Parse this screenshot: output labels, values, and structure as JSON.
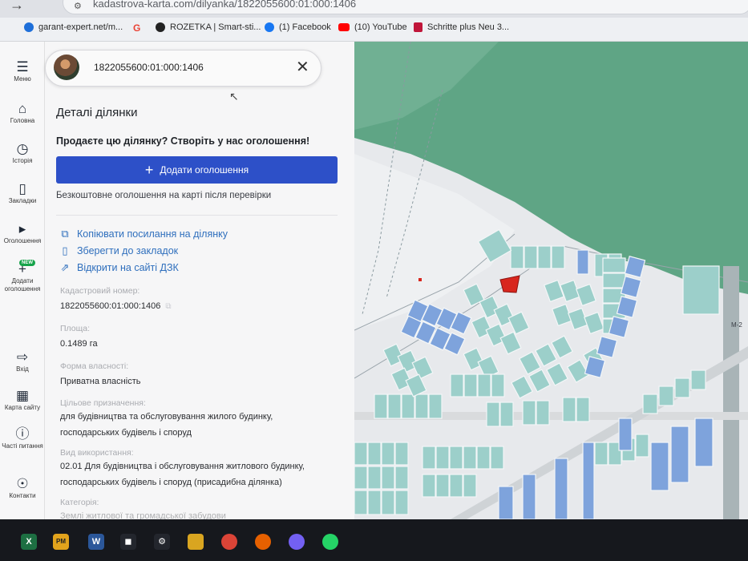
{
  "browser": {
    "url": "kadastrova-karta.com/dilyanka/1822055600:01:000:1406",
    "bookmarks": [
      {
        "label": "garant-expert.net/m...",
        "icon": "drop-icon",
        "color": "#1e6fd9"
      },
      {
        "label": "",
        "icon": "google-icon",
        "color": "#ea4335"
      },
      {
        "label": "ROZETKA | Smart-sti...",
        "icon": "rozetka-icon",
        "color": "#222222"
      },
      {
        "label": "(1) Facebook",
        "icon": "facebook-icon",
        "color": "#1877f2"
      },
      {
        "label": "(10) YouTube",
        "icon": "youtube-icon",
        "color": "#ff0000"
      },
      {
        "label": "Schritte plus Neu 3...",
        "icon": "book-icon",
        "color": "#c0163a"
      }
    ]
  },
  "sidebar": {
    "items": [
      {
        "label": "Меню",
        "icon": "hamburger-icon"
      },
      {
        "label": "Головна",
        "icon": "home-icon"
      },
      {
        "label": "Історія",
        "icon": "clock-icon"
      },
      {
        "label": "Закладки",
        "icon": "bookmark-icon"
      },
      {
        "label": "Оголошення",
        "icon": "megaphone-icon"
      },
      {
        "label": "Додати оголошення",
        "icon": "plus-icon",
        "badge": "NEW"
      },
      {
        "label": "Вхід",
        "icon": "login-icon"
      },
      {
        "label": "Карта сайту",
        "icon": "map-icon"
      },
      {
        "label": "Часті питання",
        "icon": "question-icon"
      },
      {
        "label": "Контакти",
        "icon": "chat-icon"
      }
    ]
  },
  "panel": {
    "search_value": "1822055600:01:000:1406",
    "title": "Деталі ділянки",
    "sell_question": "Продаєте цю ділянку? Створіть у нас оголошення!",
    "add_button": "Додати оголошення",
    "free_note": "Безкоштовне оголошення на карті після перевірки",
    "links": [
      {
        "label": "Копіювати посилання на ділянку",
        "icon": "copy-icon"
      },
      {
        "label": "Зберегти до закладок",
        "icon": "bookmark-icon"
      },
      {
        "label": "Відкрити на сайті ДЗК",
        "icon": "external-link-icon"
      }
    ],
    "fields": [
      {
        "label": "Кадастровий номер:",
        "value": "1822055600:01:000:1406"
      },
      {
        "label": "Площа:",
        "value": "0.1489 га"
      },
      {
        "label": "Форма власності:",
        "value": "Приватна власність"
      },
      {
        "label": "Цільове призначення:",
        "value": "для будівництва та обслуговування жилого будинку, господарських будівель і споруд"
      },
      {
        "label": "Вид використання:",
        "value": "02.01 Для будівництва і обслуговування житлового будинку, господарських будівель і споруд (присадибна ділянка)"
      },
      {
        "label": "Категорія:",
        "value": "Землі житлової та громадської забудови"
      }
    ]
  },
  "map": {
    "road_label": "М-2",
    "colors": {
      "forest": "#5fa585",
      "parcel_teal": "#9ccfca",
      "parcel_blue": "#7ea3dc",
      "selected": "#d8261e",
      "background": "#e7e9ec"
    }
  },
  "taskbar": {
    "apps": [
      {
        "label": "X",
        "icon": "excel-icon",
        "color": "#1d6f42"
      },
      {
        "label": "PM",
        "icon": "pm-icon",
        "color": "#e2a31c"
      },
      {
        "label": "W",
        "icon": "word-icon",
        "color": "#2b579a"
      },
      {
        "label": "",
        "icon": "shield-icon",
        "color": "#23262d"
      },
      {
        "label": "",
        "icon": "gear-icon",
        "color": "#23262d"
      },
      {
        "label": "",
        "icon": "folder-icon",
        "color": "#d9a520"
      },
      {
        "label": "",
        "icon": "chrome-icon",
        "color": "#db4437"
      },
      {
        "label": "",
        "icon": "firefox-icon",
        "color": "#e66000"
      },
      {
        "label": "",
        "icon": "viber-icon",
        "color": "#7360f2"
      },
      {
        "label": "",
        "icon": "whatsapp-icon",
        "color": "#25d366"
      }
    ]
  }
}
